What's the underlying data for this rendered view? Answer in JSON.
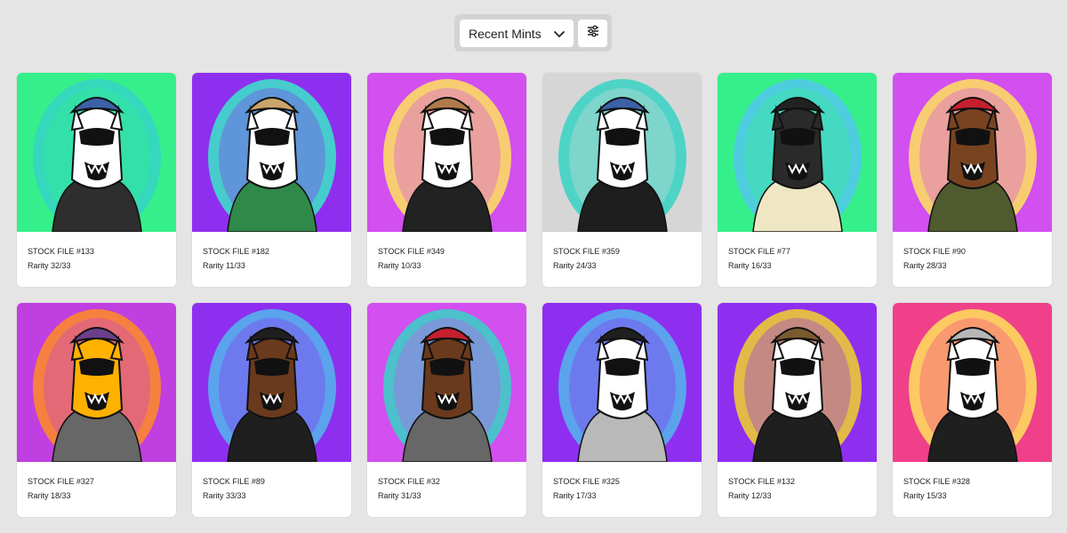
{
  "toolbar": {
    "sort_label": "Recent Mints",
    "sort_icon": "chevron-down-icon",
    "filter_icon": "sliders-icon"
  },
  "cards": [
    {
      "title": "STOCK FILE #133",
      "rarity": "Rarity 32/33",
      "bg": "#35f08a",
      "aura": "#35d3c4",
      "fur": "#ffffff",
      "hat": "#3b61a7",
      "shirt": "#2e2e2e"
    },
    {
      "title": "STOCK FILE #182",
      "rarity": "Rarity 11/33",
      "bg": "#8e2ff0",
      "aura": "#3ae8c6",
      "fur": "#ffffff",
      "hat": "#c9a46b",
      "shirt": "#2f8a4a"
    },
    {
      "title": "STOCK FILE #349",
      "rarity": "Rarity 10/33",
      "bg": "#d24ff0",
      "aura": "#ffe35a",
      "fur": "#ffffff",
      "hat": "#b07b4a",
      "shirt": "#222222"
    },
    {
      "title": "STOCK FILE #359",
      "rarity": "Rarity 24/33",
      "bg": "#d6d6d6",
      "aura": "#35d3c4",
      "fur": "#ffffff",
      "hat": "#3b61a7",
      "shirt": "#1e1e1e"
    },
    {
      "title": "STOCK FILE #77",
      "rarity": "Rarity 16/33",
      "bg": "#35f08a",
      "aura": "#52c7ec",
      "fur": "#2a2a2a",
      "hat": "#222222",
      "shirt": "#efe7c4"
    },
    {
      "title": "STOCK FILE #90",
      "rarity": "Rarity 28/33",
      "bg": "#d24ff0",
      "aura": "#ffe35a",
      "fur": "#7a4320",
      "hat": "#c51f2f",
      "shirt": "#4f5a2e"
    },
    {
      "title": "STOCK FILE #327",
      "rarity": "Rarity 18/33",
      "bg": "#c03fe0",
      "aura": "#ff8c22",
      "fur": "#ffb100",
      "hat": "#6a3f8c",
      "shirt": "#676767"
    },
    {
      "title": "STOCK FILE #89",
      "rarity": "Rarity 33/33",
      "bg": "#8e2ff0",
      "aura": "#52b7ec",
      "fur": "#6b3a1c",
      "hat": "#1f1f1f",
      "shirt": "#1f1f1f"
    },
    {
      "title": "STOCK FILE #32",
      "rarity": "Rarity 31/33",
      "bg": "#d24ff0",
      "aura": "#35d3c4",
      "fur": "#6b3a1c",
      "hat": "#c51f2f",
      "shirt": "#676767"
    },
    {
      "title": "STOCK FILE #325",
      "rarity": "Rarity 17/33",
      "bg": "#8e2ff0",
      "aura": "#52b7ec",
      "fur": "#ffffff",
      "hat": "#1f1f1f",
      "shirt": "#b9b9b9"
    },
    {
      "title": "STOCK FILE #132",
      "rarity": "Rarity 12/33",
      "bg": "#8e2ff0",
      "aura": "#f0d22a",
      "fur": "#ffffff",
      "hat": "#7a5a2e",
      "shirt": "#1f1f1f"
    },
    {
      "title": "STOCK FILE #328",
      "rarity": "Rarity 15/33",
      "bg": "#f0408a",
      "aura": "#ffe35a",
      "fur": "#ffffff",
      "hat": "#b7b7b7",
      "shirt": "#1f1f1f"
    }
  ]
}
